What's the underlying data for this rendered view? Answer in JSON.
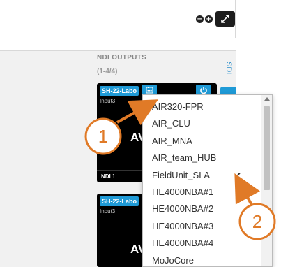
{
  "section": {
    "title": "NDI OUTPUTS",
    "count": "(1-4/4)",
    "side_tab": "SDI"
  },
  "zoom": {
    "minus": "−",
    "plus": "+"
  },
  "cards": [
    {
      "label": "SH-22-Labo",
      "input": "Input3",
      "preview_text": "AV",
      "footer": "NDI 1"
    },
    {
      "label": "SH-22-Labo",
      "input": "Input3",
      "preview_text": "AV",
      "footer": ""
    }
  ],
  "dropdown": {
    "items": [
      {
        "label": "AIR320-FPR",
        "selected": false
      },
      {
        "label": "AIR_CLU",
        "selected": false
      },
      {
        "label": "AIR_MNA",
        "selected": false
      },
      {
        "label": "AIR_team_HUB",
        "selected": false
      },
      {
        "label": "FieldUnit_SLA",
        "selected": true
      },
      {
        "label": "HE4000NBA#1",
        "selected": false
      },
      {
        "label": "HE4000NBA#2",
        "selected": false
      },
      {
        "label": "HE4000NBA#3",
        "selected": false
      },
      {
        "label": "HE4000NBA#4",
        "selected": false
      },
      {
        "label": "MoJoCore",
        "selected": false
      }
    ],
    "check": "✔"
  },
  "annotations": [
    {
      "number": "1"
    },
    {
      "number": "2"
    }
  ],
  "colors": {
    "accent": "#1f9ad6",
    "annotation": "#e07a27"
  }
}
